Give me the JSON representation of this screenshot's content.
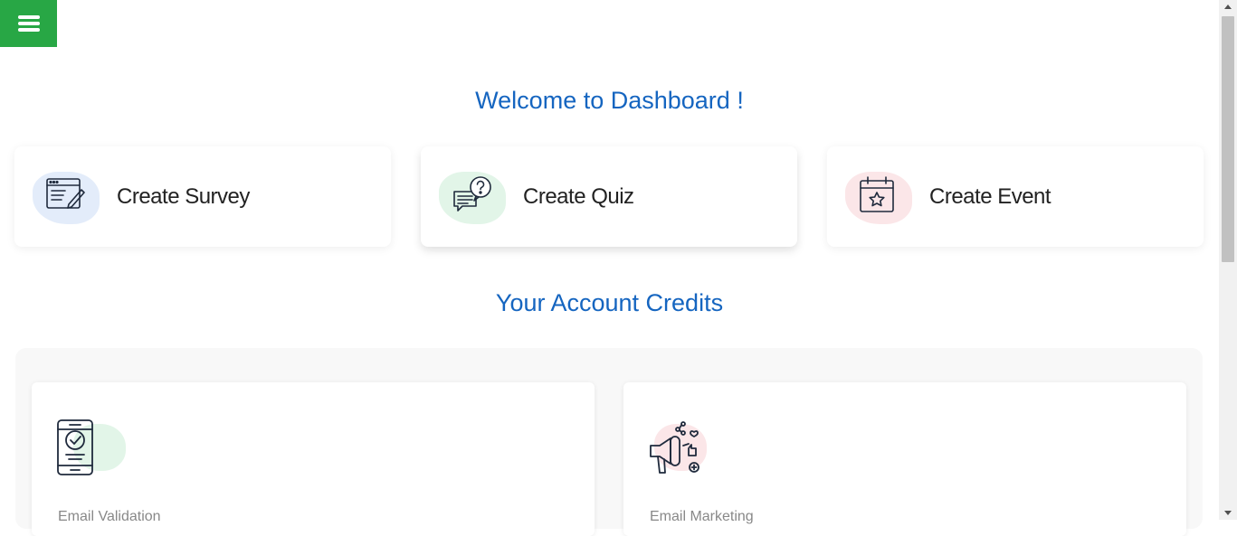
{
  "nav": {
    "menu_icon": "hamburger-menu-icon"
  },
  "header": {
    "welcome_title": "Welcome to Dashboard !"
  },
  "actions": [
    {
      "label": "Create Survey",
      "icon": "survey-form-icon",
      "accent": "#e3ecfa"
    },
    {
      "label": "Create Quiz",
      "icon": "quiz-question-icon",
      "accent": "#e2f5e8"
    },
    {
      "label": "Create Event",
      "icon": "event-calendar-icon",
      "accent": "#fbe6e8"
    }
  ],
  "credits": {
    "title": "Your Account Credits",
    "cards": [
      {
        "label": "Email Validation",
        "icon": "phone-check-icon",
        "accent": "#e2f5e8"
      },
      {
        "label": "Email Marketing",
        "icon": "megaphone-social-icon",
        "accent": "#fbe6e8"
      }
    ]
  },
  "colors": {
    "primary": "#1565c0",
    "menu": "#28a745",
    "text": "#222222",
    "muted": "#888888",
    "icon": "#1f2a3c"
  }
}
